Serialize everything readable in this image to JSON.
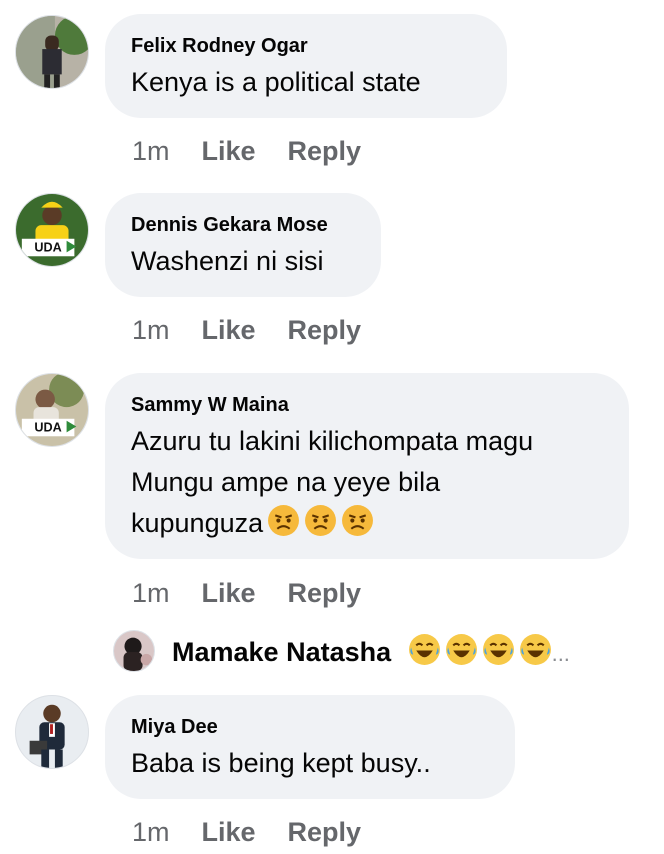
{
  "comments": [
    {
      "author": "Felix Rodney Ogar",
      "text": "Kenya is a political  state",
      "time": "1m",
      "like": "Like",
      "reply": "Reply",
      "avatar_icon": "person-outdoor-avatar"
    },
    {
      "author": "Dennis Gekara Mose",
      "text": "Washenzi ni sisi",
      "time": "1m",
      "like": "Like",
      "reply": "Reply",
      "avatar_icon": "uda-badge-avatar"
    },
    {
      "author": "Sammy W Maina",
      "text": "Azuru tu lakini kilichompata magu\nMungu ampe na yeye bila\nkupunguza",
      "time": "1m",
      "like": "Like",
      "reply": "Reply",
      "avatar_icon": "uda-badge-avatar",
      "emojis": [
        "angry-face",
        "angry-face",
        "angry-face"
      ]
    },
    {
      "author": "Miya Dee",
      "text": "Baba is being  kept busy..",
      "time": "1m",
      "like": "Like",
      "reply": "Reply",
      "avatar_icon": "person-suit-avatar"
    }
  ],
  "reply_preview": {
    "author": "Mamake Natasha",
    "emojis": [
      "laughing-tears-face",
      "laughing-tears-face",
      "laughing-tears-face",
      "laughing-tears-face"
    ],
    "ellipsis": "..."
  },
  "colors": {
    "bubble": "#f0f2f5",
    "secondary_text": "#65676b",
    "primary_text": "#050505",
    "uda_yellow": "#f7d117"
  }
}
